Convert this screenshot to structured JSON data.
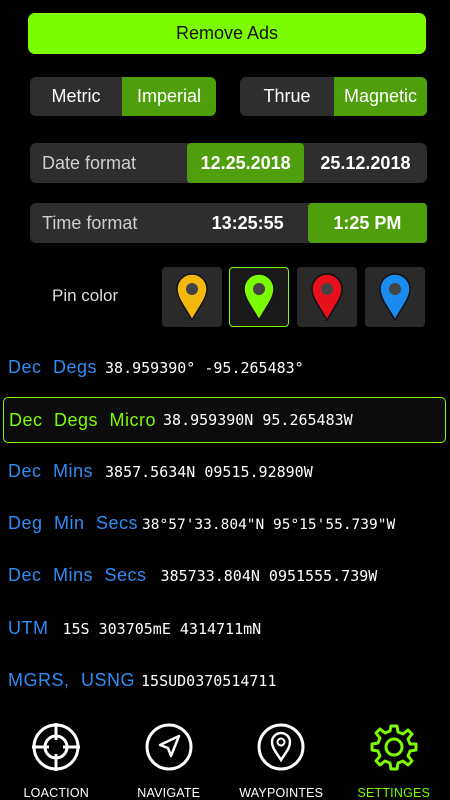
{
  "remove_ads": "Remove Ads",
  "units": {
    "metric": "Metric",
    "imperial": "Imperial",
    "selected": "imperial"
  },
  "north": {
    "thrue": "Thrue",
    "magnetic": "Magnetic",
    "selected": "magnetic"
  },
  "date_format": {
    "label": "Date format",
    "us": "12.25.2018",
    "eu": "25.12.2018",
    "selected": "us"
  },
  "time_format": {
    "label": "Time format",
    "h24": "13:25:55",
    "h12": "1:25 PM",
    "selected": "h12"
  },
  "pin_color": {
    "label": "Pin color",
    "options": [
      {
        "color": "#f2b90c",
        "icon": "yellow-pin-icon"
      },
      {
        "color": "#7CFC00",
        "icon": "green-pin-icon",
        "selected": true
      },
      {
        "color": "#e8101a",
        "icon": "red-pin-icon"
      },
      {
        "color": "#1a8cf0",
        "icon": "blue-pin-icon"
      }
    ]
  },
  "coords": [
    {
      "name": "Dec  Degs",
      "value": "38.959390°  -95.265483°"
    },
    {
      "name": "Dec  Degs  Micro",
      "value": "38.959390N   95.265483W",
      "selected": true
    },
    {
      "name": "Dec  Mins",
      "value": "3857.5634N     09515.92890W"
    },
    {
      "name": "Deg  Min  Secs",
      "value": "38°57'33.804\"N 95°15'55.739\"W"
    },
    {
      "name": "Dec  Mins  Secs",
      "value": "385733.804N   0951555.739W"
    },
    {
      "name": "UTM",
      "value": "15S  303705mE   4314711mN"
    },
    {
      "name": "MGRS,  USNG",
      "value": "15SUD0370514711"
    }
  ],
  "nav": {
    "location": "LOACTION",
    "navigate": "NAVIGATE",
    "waypoints": "WAYPOINTES",
    "settings": "SETTINGES",
    "active": "settings"
  },
  "colors": {
    "accent": "#7CFC00",
    "selected_bg": "#4f9f0c",
    "link_blue": "#2f8cf5",
    "panel": "#2e2e2e"
  }
}
